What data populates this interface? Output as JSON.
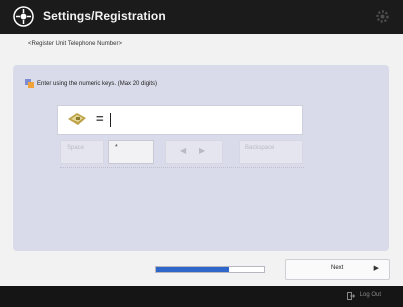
{
  "header": {
    "title": "Settings/Registration"
  },
  "breadcrumb": "<Register Unit Telephone Number>",
  "instruction": "Enter using the numeric keys. (Max 20 digits)",
  "entry": {
    "prefix": "=",
    "value": ""
  },
  "keys": {
    "space_label": "Space",
    "dropdown_value": "*",
    "left_arrow": "◀",
    "right_arrow": "▶",
    "backspace_label": "Backspace"
  },
  "progress": {
    "fraction": 0.68
  },
  "next_button": {
    "label": "Next",
    "arrow": "▶"
  },
  "footer": {
    "logout_label": "Log Out"
  },
  "colors": {
    "header_bg": "#1b1b1b",
    "panel_bg": "#dadbea",
    "progress_fill": "#2e67c9",
    "footer_bg": "#151515"
  },
  "icons": [
    "settings-menu-icon",
    "gear-icon",
    "keypad-hand-icon",
    "phone-icon",
    "logout-icon"
  ]
}
